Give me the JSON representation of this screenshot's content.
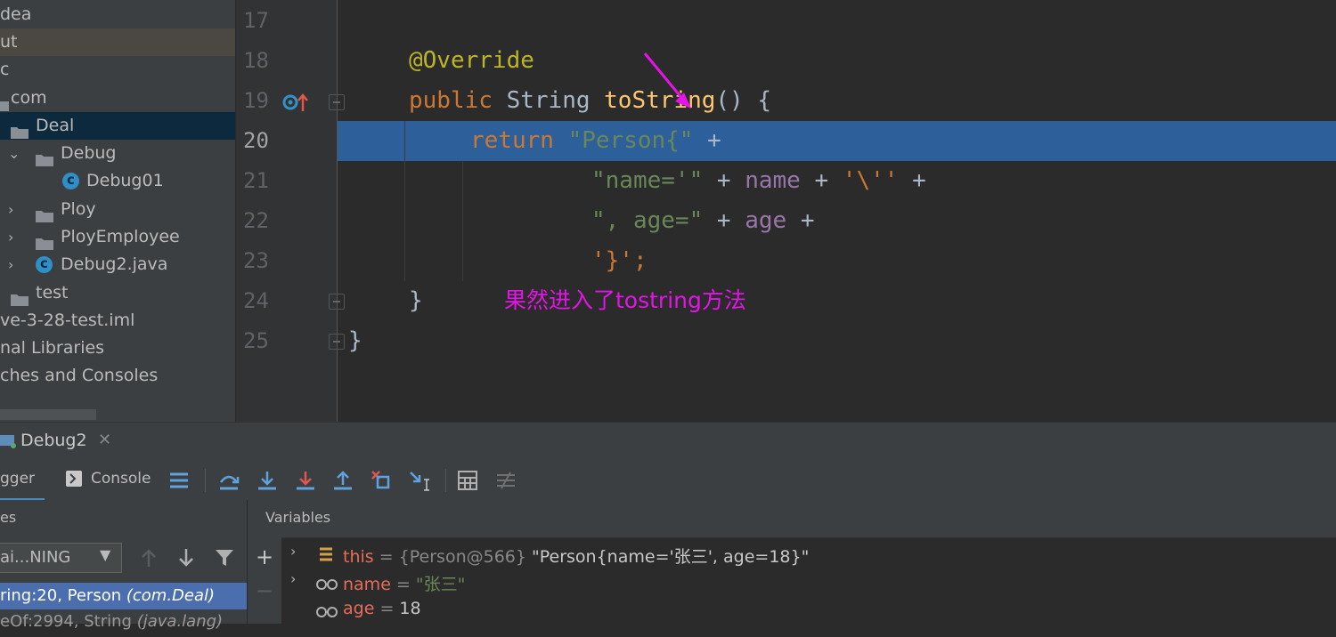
{
  "project_tree": {
    "items": [
      {
        "label": "dea"
      },
      {
        "label": "ut"
      },
      {
        "label": "c"
      },
      {
        "label": "com"
      },
      {
        "label": "Deal"
      },
      {
        "label": "Debug"
      },
      {
        "label": "Debug01"
      },
      {
        "label": "Ploy"
      },
      {
        "label": "PloyEmployee"
      },
      {
        "label": "Debug2.java"
      },
      {
        "label": "test"
      },
      {
        "label": "ve-3-28-test.iml"
      },
      {
        "label": "nal Libraries"
      },
      {
        "label": "ches and Consoles"
      }
    ]
  },
  "editor": {
    "line_numbers": [
      "17",
      "18",
      "19",
      "20",
      "21",
      "22",
      "23",
      "24",
      "25"
    ],
    "current_line": "20",
    "lines": {
      "l18_annotation": "@Override",
      "l19_public": "public",
      "l19_type": " String ",
      "l19_method": "toString",
      "l19_rest": "() {",
      "l20_return": "return",
      "l20_str": "\"Person{\"",
      "l20_plus": " +",
      "l21_str1": "\"name='\"",
      "l21_plus1": " + ",
      "l21_name": "name",
      "l21_plus2": " + ",
      "l21_char": "'\\''",
      "l21_plus3": " +",
      "l22_str": "\", age=\"",
      "l22_plus1": " + ",
      "l22_age": "age",
      "l22_plus2": " +",
      "l23_char": "'}'",
      "l23_semi": ";",
      "l24_brace": "}",
      "l25_brace": "}"
    },
    "annotation_note": "果然进入了tostring方法"
  },
  "debug": {
    "tab_label": "Debug2",
    "tabs": {
      "debugger": "gger",
      "console": "Console"
    },
    "frames_header": "es",
    "thread_select": "ai...NING",
    "selected_frame": {
      "text": "ring:20, Person ",
      "pkg": "(com.Deal)"
    },
    "next_frame": {
      "text": "eOf:2994, String ",
      "pkg": "(java.lang)"
    },
    "variables_header": "Variables",
    "variables": [
      {
        "name": "this",
        "eq": " = ",
        "ref": "{Person@566}",
        "value": " \"Person{name='张三', age=18}\""
      },
      {
        "name": "name",
        "eq": " = ",
        "value": "\"张三\""
      },
      {
        "name": "age",
        "eq": " = ",
        "value": "18"
      }
    ]
  },
  "colors": {
    "keyword": "#cc7832",
    "string": "#6a8759",
    "field": "#9876aa",
    "annotation": "#bbb529",
    "method": "#ffc66d",
    "execution_line": "#2d5f9b",
    "note": "#e414e8"
  }
}
